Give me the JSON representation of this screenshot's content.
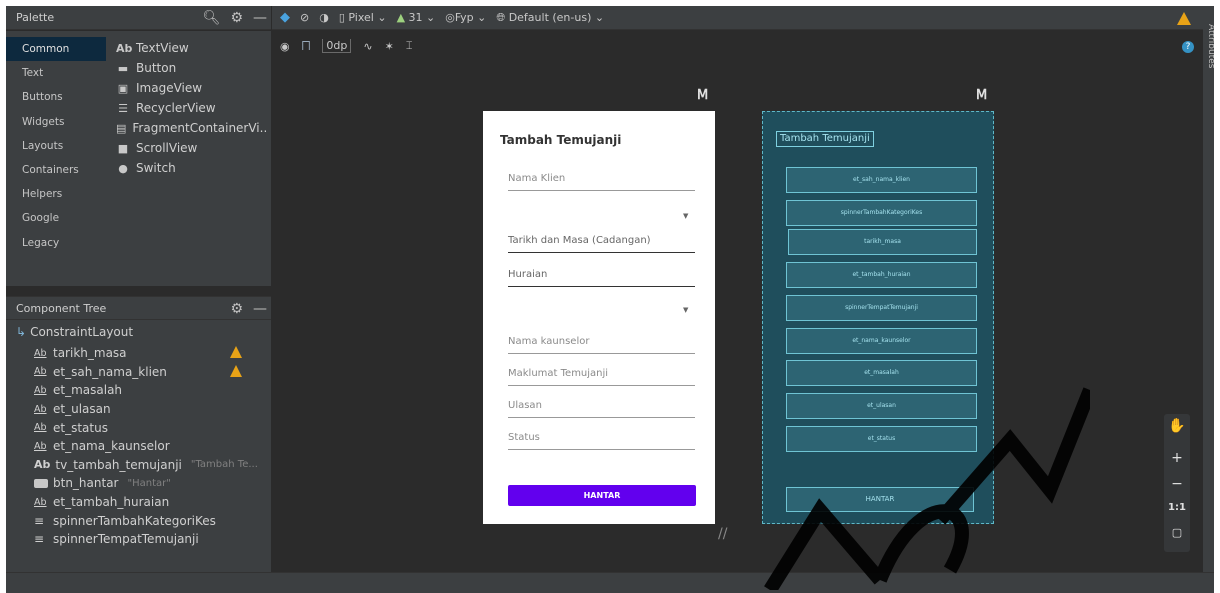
{
  "palette": {
    "title": "Palette",
    "categories": [
      "Common",
      "Text",
      "Buttons",
      "Widgets",
      "Layouts",
      "Containers",
      "Helpers",
      "Google",
      "Legacy"
    ],
    "items": [
      {
        "icon": "Ab",
        "label": "TextView"
      },
      {
        "icon": "button",
        "label": "Button"
      },
      {
        "icon": "image",
        "label": "ImageView"
      },
      {
        "icon": "list",
        "label": "RecyclerView"
      },
      {
        "icon": "fragment",
        "label": "FragmentContainerVi..."
      },
      {
        "icon": "scroll",
        "label": "ScrollView"
      },
      {
        "icon": "switch",
        "label": "Switch"
      }
    ]
  },
  "toolbar": {
    "device": "Pixel",
    "api": "31",
    "theme": "Fyp",
    "locale": "Default (en-us)",
    "margin": "0dp"
  },
  "component_tree": {
    "title": "Component Tree",
    "root": "ConstraintLayout",
    "items": [
      {
        "type": "et",
        "label": "tarikh_masa",
        "sub": "",
        "warn": true
      },
      {
        "type": "et",
        "label": "et_sah_nama_klien",
        "sub": "",
        "warn": true
      },
      {
        "type": "et",
        "label": "et_masalah",
        "sub": "",
        "warn": false
      },
      {
        "type": "et",
        "label": "et_ulasan",
        "sub": "",
        "warn": false
      },
      {
        "type": "et",
        "label": "et_status",
        "sub": "",
        "warn": false
      },
      {
        "type": "et",
        "label": "et_nama_kaunselor",
        "sub": "",
        "warn": false
      },
      {
        "type": "tv",
        "label": "tv_tambah_temujanji",
        "sub": "\"Tambah Te...",
        "warn": false
      },
      {
        "type": "btn",
        "label": "btn_hantar",
        "sub": "\"Hantar\"",
        "warn": false
      },
      {
        "type": "et",
        "label": "et_tambah_huraian",
        "sub": "",
        "warn": false
      },
      {
        "type": "spinner",
        "label": "spinnerTambahKategoriKes",
        "sub": "",
        "warn": false
      },
      {
        "type": "spinner",
        "label": "spinnerTempatTemujanji",
        "sub": "",
        "warn": false
      }
    ]
  },
  "design": {
    "title": "Tambah Temujanji",
    "fields": [
      "Nama Klien",
      "",
      "Tarikh dan Masa (Cadangan)",
      "Huraian",
      "",
      "Nama kaunselor",
      "Maklumat Temujanji",
      "Ulasan",
      "Status"
    ],
    "button": "HANTAR"
  },
  "blueprint": {
    "title": "Tambah Temujanji",
    "boxes": [
      "et_sah_nama_klien",
      "spinnerTambahKategoriKes",
      "tarikh_masa",
      "et_tambah_huraian",
      "spinnerTempatTemujanji",
      "et_nama_kaunselor",
      "et_masalah",
      "et_ulasan",
      "et_status"
    ],
    "button": "HANTAR"
  },
  "attributes_label": "Attributes",
  "zoom_label": "1:1"
}
